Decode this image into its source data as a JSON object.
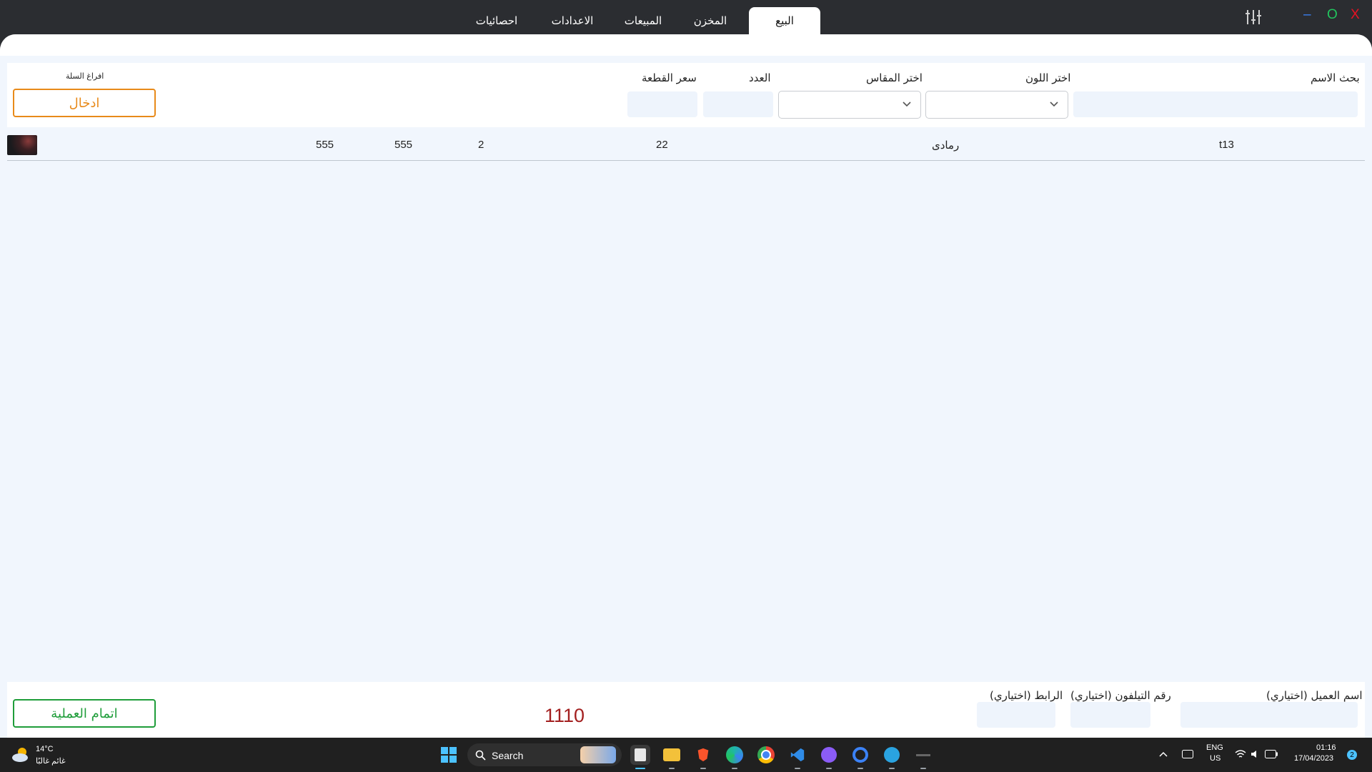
{
  "tabs": [
    {
      "label": "البيع",
      "active": true
    },
    {
      "label": "المخزن"
    },
    {
      "label": "المبيعات"
    },
    {
      "label": "الاعدادات"
    },
    {
      "label": "احصائيات"
    }
  ],
  "window_controls": {
    "close": "X",
    "maximize": "O",
    "minimize": "–"
  },
  "form": {
    "search_name_label": "بحث الاسم",
    "color_label": "اختر اللون",
    "size_label": "اختر المقاس",
    "count_label": "العدد",
    "price_label": "سعر القطعة",
    "empty_cart_label": "افراغ السلة",
    "enter_button": "ادخال"
  },
  "cart_rows": [
    {
      "name": "t13",
      "color": "رمادى",
      "size": "22",
      "count": "2",
      "price": "555",
      "total": "555"
    }
  ],
  "footer": {
    "customer_name_label": "اسم العميل (اختياري)",
    "phone_label": "رقم التيلفون (اختياري)",
    "link_label": "الرابط (اختياري)",
    "total": "1110",
    "complete_button": "اتمام العملية"
  },
  "taskbar": {
    "weather_temp": "14°C",
    "weather_text": "غائم غالبًا",
    "search_label": "Search",
    "lang_top": "ENG",
    "lang_bottom": "US",
    "time": "01:16",
    "date": "17/04/2023",
    "notifications": "2"
  },
  "colors": {
    "accent_orange": "#e88a1a",
    "accent_green": "#1f9d3a",
    "total_red": "#a32020",
    "close_red": "#e81123",
    "maximize_green": "#22c55e",
    "minimize_blue": "#3b82f6"
  }
}
